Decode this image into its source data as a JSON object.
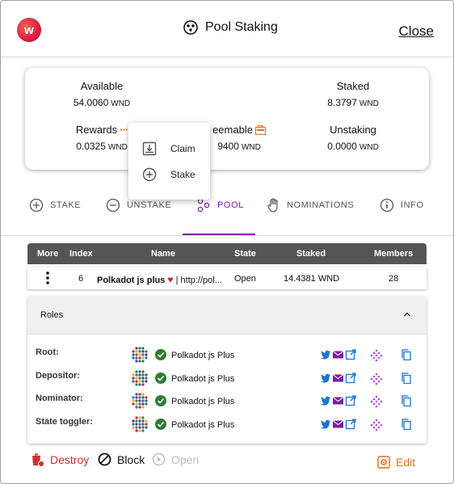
{
  "header": {
    "logo_text": "w",
    "title": "Pool Staking",
    "close_label": "Close"
  },
  "balances": {
    "available": {
      "label": "Available",
      "value": "54.0060",
      "unit": "WND"
    },
    "staked": {
      "label": "Staked",
      "value": "8.3797",
      "unit": "WND"
    },
    "rewards": {
      "label": "Rewards",
      "value": "0.0325",
      "unit": "WND"
    },
    "redeemable": {
      "label": "eemable",
      "value": "9400",
      "unit": "WND"
    },
    "unstaking": {
      "label": "Unstaking",
      "value": "0.0000",
      "unit": "WND"
    }
  },
  "rewards_menu": {
    "items": [
      {
        "label": "Claim",
        "icon": "download-icon"
      },
      {
        "label": "Stake",
        "icon": "add-circle-icon"
      }
    ]
  },
  "tabs": [
    {
      "label": "STAKE",
      "icon": "add-circle-icon"
    },
    {
      "label": "UNSTAKE",
      "icon": "remove-circle-icon"
    },
    {
      "label": "POOL",
      "icon": "pool-icon"
    },
    {
      "label": "NOMINATIONS",
      "icon": "hand-icon"
    },
    {
      "label": "INFO",
      "icon": "info-icon"
    }
  ],
  "active_tab": "POOL",
  "pool_table": {
    "headers": [
      "More",
      "Index",
      "Name",
      "State",
      "Staked",
      "Members"
    ],
    "row": {
      "index": "6",
      "name": "Polkadot js plus",
      "name_suffix": "| http://pol...",
      "state": "Open",
      "staked": "14.4381 WND",
      "members": "28"
    }
  },
  "roles": {
    "title": "Roles",
    "rows": [
      {
        "role": "Root:",
        "name": "Polkadot js Plus"
      },
      {
        "role": "Depositor:",
        "name": "Polkadot js Plus"
      },
      {
        "role": "Nominator:",
        "name": "Polkadot js Plus"
      },
      {
        "role": "State toggler:",
        "name": "Polkadot js Plus"
      }
    ]
  },
  "footer": {
    "destroy_label": "Destroy",
    "block_label": "Block",
    "open_label": "Open",
    "edit_label": "Edit"
  },
  "colors": {
    "accent": "#7b1fa2",
    "orange": "#e0701a",
    "destroy": "#d32f2f",
    "twitter": "#1976d2",
    "mail": "#7b1fa2"
  }
}
